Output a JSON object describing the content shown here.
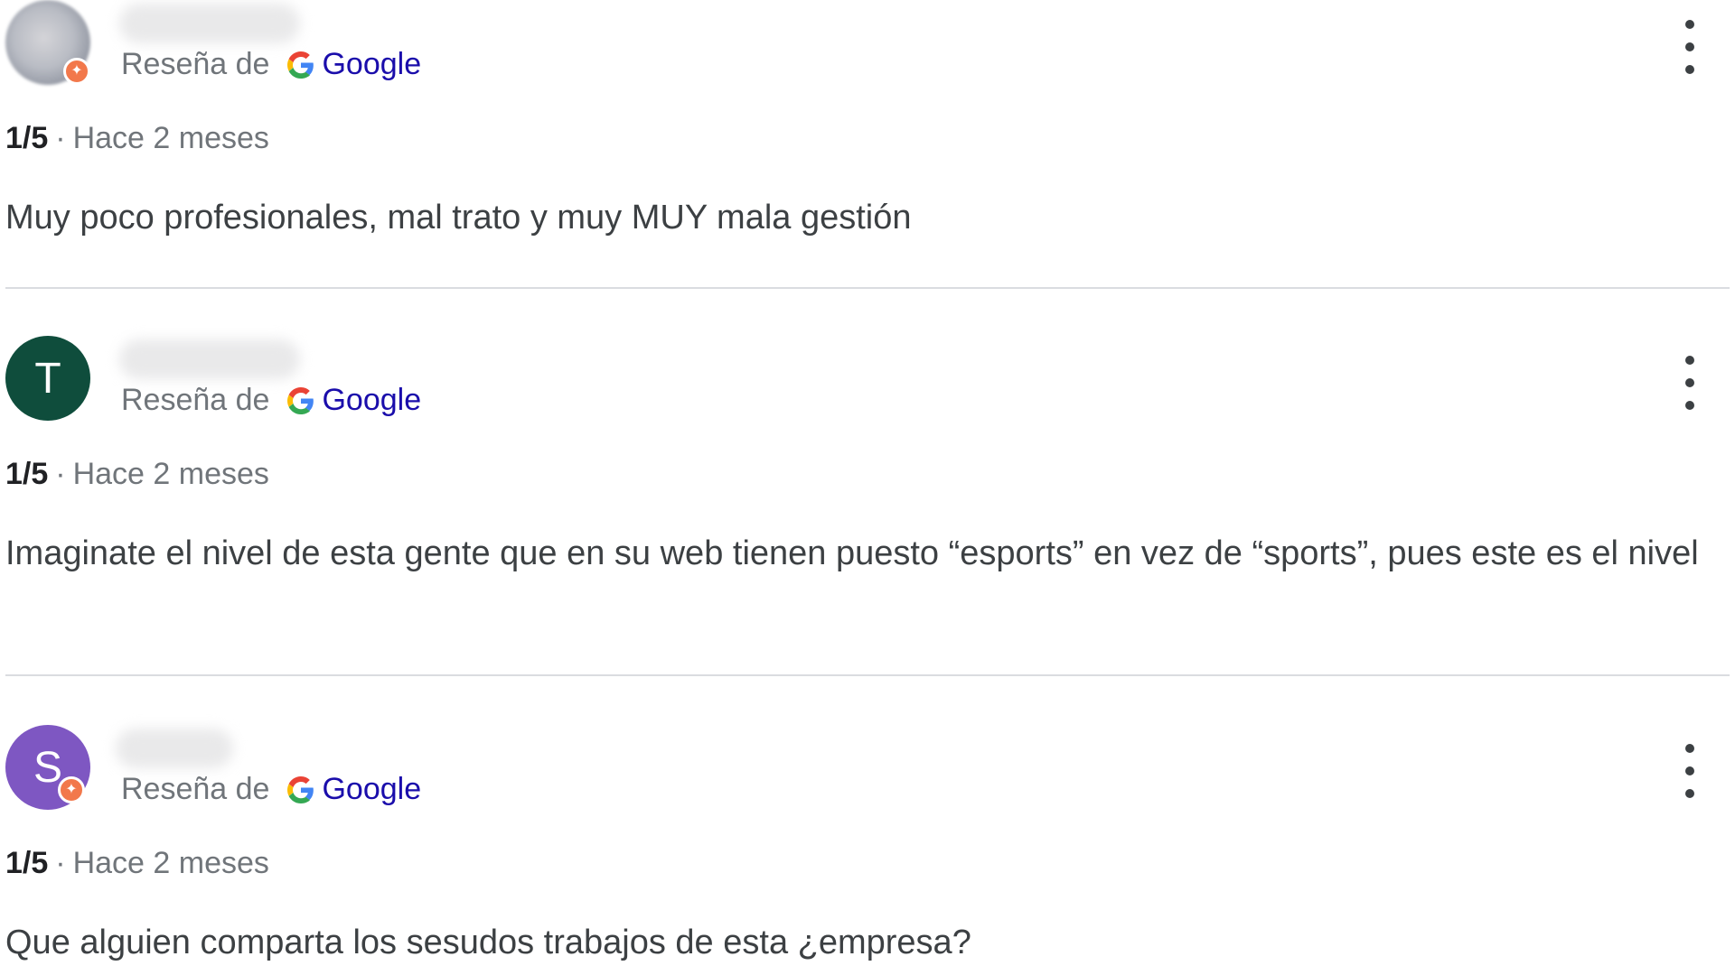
{
  "reviews": [
    {
      "avatar_letter": "",
      "avatar_color": "#9aa0a6",
      "badge": true,
      "source_prefix": "Reseña de",
      "source_name": "Google",
      "score": "1/5",
      "separator": "·",
      "time": "Hace 2 meses",
      "text": "Muy poco profesionales, mal trato y muy MUY mala gestión"
    },
    {
      "avatar_letter": "T",
      "avatar_color": "#0f4d3c",
      "badge": false,
      "source_prefix": "Reseña de",
      "source_name": "Google",
      "score": "1/5",
      "separator": "·",
      "time": "Hace 2 meses",
      "text": "Imaginate el nivel de esta gente que en su web tienen puesto “esports” en vez de “sports”, pues este es el nivel"
    },
    {
      "avatar_letter": "S",
      "avatar_color": "#7e57c2",
      "badge": true,
      "source_prefix": "Reseña de",
      "source_name": "Google",
      "score": "1/5",
      "separator": "·",
      "time": "Hace 2 meses",
      "text": "Que alguien comparta los sesudos trabajos de esta ¿empresa?"
    }
  ],
  "colors": {
    "link": "#1a0dab",
    "muted": "#70757a",
    "badge": "#f2784b",
    "divider": "#dadce0"
  },
  "icons": {
    "google": "google-g-icon",
    "menu": "more-vert-icon",
    "badge": "local-guide-badge-icon"
  }
}
